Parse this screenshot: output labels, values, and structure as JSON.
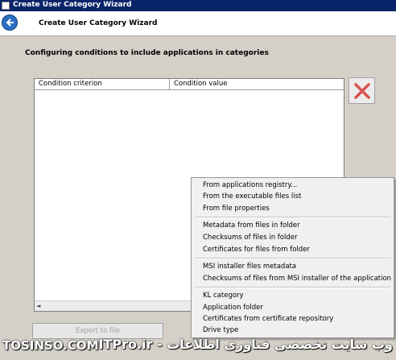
{
  "window": {
    "title": "Create User Category Wizard"
  },
  "header": {
    "title": "Create User Category Wizard"
  },
  "page": {
    "heading": "Configuring conditions to include applications in categories"
  },
  "table": {
    "columns": [
      "Condition criterion",
      "Condition value"
    ],
    "rows": []
  },
  "export_button": {
    "label": "Export to file"
  },
  "menu": {
    "groups": [
      [
        "From applications registry...",
        "From the executable files list",
        "From file properties"
      ],
      [
        "Metadata from files in folder",
        "Checksums of files in folder",
        "Certificates for files from folder"
      ],
      [
        "MSI installer files metadata",
        "Checksums of files from MSI installer of the application"
      ],
      [
        "KL category",
        "Application folder",
        "Certificates from certificate repository",
        "Drive type"
      ]
    ]
  },
  "watermark": {
    "left": "TOSINSO.COM",
    "right": "وب سایت تخصصی فناوری اطلاعات - ITPro.ir"
  },
  "colors": {
    "titlebar": "#0a246a",
    "delete_icon": "#d9534f",
    "back_button": "#2a6fc0"
  }
}
